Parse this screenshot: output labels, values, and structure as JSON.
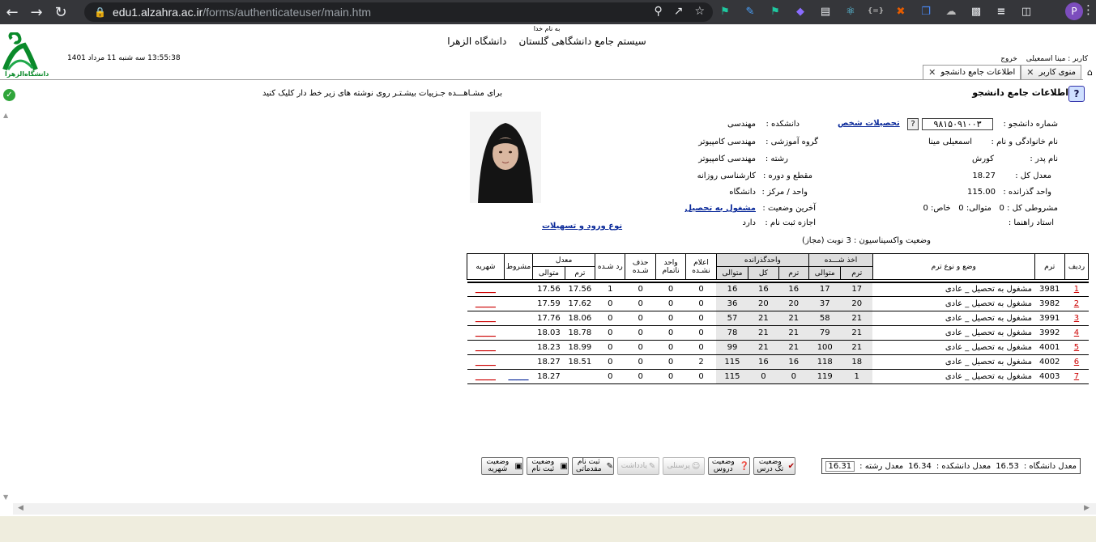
{
  "browser": {
    "url_host": "edu1.alzahra.ac.ir",
    "url_path": "/forms/authenticateuser/main.htm",
    "profile_initial": "P"
  },
  "header": {
    "besmellah": "به نام خدا",
    "system_title": "سیستم جامع دانشگاهی گلستان    دانشگاه الزهرا",
    "datetime": "13:55:38 سه شنبه 11 مرداد 1401",
    "logo_text": "دانشگاه‌الزهرا",
    "user_label": "کاربر : مینا اسمعیلی",
    "logout": "خروج"
  },
  "tabs": [
    {
      "label": "منوی کاربر"
    },
    {
      "label": "اطلاعات جامع دانشجو"
    }
  ],
  "page": {
    "title": "اطلاعات جامع دانشجو",
    "hint": "برای مشـاهـــده جـزییات بیشـتـر روی نوشته های زیر خط دار کلیک کنید"
  },
  "student": {
    "student_no_label": "شماره دانشجو :",
    "student_no": "۹۸۱۵۰۹۱۰۰۳",
    "personal_link": "تحصیلات شخص",
    "faculty_label": "دانشکده :",
    "faculty": "مهندسی",
    "name_label": "نام خانوادگی و نام :",
    "name": "اسمعیلی مینا",
    "group_label": "گروه آموزشی :",
    "group": "مهندسی کامپیوتر",
    "father_label": "نام پدر :",
    "father": "کورش",
    "major_label": "رشته :",
    "major": "مهندسی کامپیوتر",
    "gpa_label": "معدل کل :",
    "gpa": "18.27",
    "level_label": "مقطع و دوره :",
    "level": "کارشناسی  روزانه",
    "units_label": "واحد گذرانده :",
    "units": "115.00",
    "center_label": "واحد / مرکز :",
    "center": "دانشگاه",
    "probation_label": "مشروطی کل :",
    "probation_total": "0",
    "probation_consec_label": "متوالی:",
    "probation_consec": "0",
    "probation_special_label": "خاص:",
    "probation_special": "0",
    "status_label": "آخرین وضعیت :",
    "status": "مشغول به تحصیل",
    "advisor_label": "استاد راهنما :",
    "reg_label": "اجازه ثبت نام :",
    "reg": "دارد",
    "entry_link": "نوع ورود و تسهیلات",
    "vaccine": "وضعیت واکسیناسیون : 3 نوبت (مجاز)"
  },
  "table": {
    "headers": {
      "row": "ردیف",
      "term": "ترم",
      "status": "وضع و نوع ترم",
      "taken_group": "اخذ شـــده",
      "passed_group": "واحدگذرانده",
      "term_col": "ترم",
      "consec_col": "متوالی",
      "total_col": "کل",
      "announced": "اعلام نشـده",
      "incomplete": "واحد ناتمام",
      "dropped": "حذف شـده",
      "rejected": "رد شـده",
      "avg_group": "معدل",
      "avg_term": "ترم",
      "avg_consec": "متوالی",
      "conditional": "مشروط",
      "tuition": "شهریه"
    },
    "rows": [
      {
        "no": "1",
        "term": "3981",
        "status": "مشغول به تحصیل _ عادی",
        "taken_term": "17",
        "taken_consec": "17",
        "passed_term": "16",
        "passed_total": "16",
        "passed_consec": "16",
        "announced": "0",
        "incomplete": "0",
        "dropped": "0",
        "rejected": "1",
        "avg_term": "17.56",
        "avg_consec": "17.56",
        "conditional": "",
        "tuition": "_____"
      },
      {
        "no": "2",
        "term": "3982",
        "status": "مشغول به تحصیل _ عادی",
        "taken_term": "20",
        "taken_consec": "37",
        "passed_term": "20",
        "passed_total": "20",
        "passed_consec": "36",
        "announced": "0",
        "incomplete": "0",
        "dropped": "0",
        "rejected": "0",
        "avg_term": "17.62",
        "avg_consec": "17.59",
        "conditional": "",
        "tuition": "_____"
      },
      {
        "no": "3",
        "term": "3991",
        "status": "مشغول به تحصیل _ عادی",
        "taken_term": "21",
        "taken_consec": "58",
        "passed_term": "21",
        "passed_total": "21",
        "passed_consec": "57",
        "announced": "0",
        "incomplete": "0",
        "dropped": "0",
        "rejected": "0",
        "avg_term": "18.06",
        "avg_consec": "17.76",
        "conditional": "",
        "tuition": "_____"
      },
      {
        "no": "4",
        "term": "3992",
        "status": "مشغول به تحصیل _ عادی",
        "taken_term": "21",
        "taken_consec": "79",
        "passed_term": "21",
        "passed_total": "21",
        "passed_consec": "78",
        "announced": "0",
        "incomplete": "0",
        "dropped": "0",
        "rejected": "0",
        "avg_term": "18.78",
        "avg_consec": "18.03",
        "conditional": "",
        "tuition": "_____"
      },
      {
        "no": "5",
        "term": "4001",
        "status": "مشغول به تحصیل _ عادی",
        "taken_term": "21",
        "taken_consec": "100",
        "passed_term": "21",
        "passed_total": "21",
        "passed_consec": "99",
        "announced": "0",
        "incomplete": "0",
        "dropped": "0",
        "rejected": "0",
        "avg_term": "18.99",
        "avg_consec": "18.23",
        "conditional": "",
        "tuition": "_____"
      },
      {
        "no": "6",
        "term": "4002",
        "status": "مشغول به تحصیل _ عادی",
        "taken_term": "18",
        "taken_consec": "118",
        "passed_term": "16",
        "passed_total": "16",
        "passed_consec": "115",
        "announced": "2",
        "incomplete": "0",
        "dropped": "0",
        "rejected": "0",
        "avg_term": "18.51",
        "avg_consec": "18.27",
        "conditional": "",
        "tuition": "_____"
      },
      {
        "no": "7",
        "term": "4003",
        "status": "مشغول به تحصیل _ عادی",
        "taken_term": "1",
        "taken_consec": "119",
        "passed_term": "0",
        "passed_total": "0",
        "passed_consec": "115",
        "announced": "0",
        "incomplete": "0",
        "dropped": "0",
        "rejected": "0",
        "avg_term": "",
        "avg_consec": "18.27",
        "conditional": "_____",
        "tuition": "_____"
      }
    ]
  },
  "averages": {
    "uni_label": "معدل دانشگاه :",
    "uni": "16.53",
    "faculty_label": "معدل دانشکده :",
    "faculty": "16.34",
    "major_label": "معدل رشته :",
    "major": "16.31"
  },
  "buttons": {
    "course_status": "وضعیت تک درس",
    "courses_status": "وضعیت دروس",
    "personnel": "پرسنلی",
    "note": "یادداشت",
    "prelim_reg": "ثبت نام مقدماتی",
    "reg_status": "وضعیت ثبت نام",
    "tuition_status": "وضعیت شهریه"
  }
}
